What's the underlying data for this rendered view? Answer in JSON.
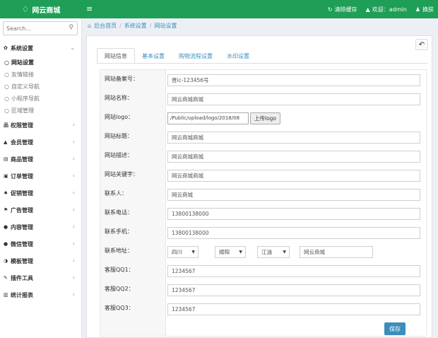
{
  "header": {
    "logo_text": "网云商城",
    "clear_cache": "清除缓存",
    "welcome": "欢迎：admin",
    "switch_skin": "换肤"
  },
  "sidebar": {
    "search_placeholder": "Search...",
    "groups": [
      {
        "label": "系统设置",
        "icon": "gear-icon",
        "expanded": true
      },
      {
        "label": "权限管理",
        "icon": "sitemap-icon"
      },
      {
        "label": "会员管理",
        "icon": "user-icon"
      },
      {
        "label": "商品管理",
        "icon": "box-icon"
      },
      {
        "label": "订单管理",
        "icon": "order-icon"
      },
      {
        "label": "促销管理",
        "icon": "bell-icon"
      },
      {
        "label": "广告管理",
        "icon": "flag-icon"
      },
      {
        "label": "内容管理",
        "icon": "comment-icon"
      },
      {
        "label": "微信管理",
        "icon": "wechat-icon"
      },
      {
        "label": "模板管理",
        "icon": "template-icon"
      },
      {
        "label": "插件工具",
        "icon": "plugin-icon"
      },
      {
        "label": "统计报表",
        "icon": "chart-icon"
      }
    ],
    "sub_items": [
      "网站设置",
      "友情链接",
      "自定义导航",
      "小程序导航",
      "区域管理"
    ]
  },
  "breadcrumb": [
    "后台首页",
    "系统设置",
    "网站设置"
  ],
  "tabs": [
    "网站信息",
    "基本设置",
    "购物流程设置",
    "水印设置"
  ],
  "form": {
    "fields": [
      {
        "label": "网站备案号：",
        "value": "晋ic-123456号"
      },
      {
        "label": "网站名称：",
        "value": "网云商城商城"
      },
      {
        "label": "网站logo：",
        "value": "/Public/upload/logo/2018/08"
      },
      {
        "label": "网站标题：",
        "value": "网云商城商城"
      },
      {
        "label": "网站描述：",
        "value": "网云商城商城"
      },
      {
        "label": "网站关键字：",
        "value": "网云商城商城"
      },
      {
        "label": "联系人：",
        "value": "网云商城"
      },
      {
        "label": "联系电话：",
        "value": "13800138000"
      },
      {
        "label": "联系手机：",
        "value": "13800138000"
      },
      {
        "label": "联系地址：",
        "value": "网云商城"
      },
      {
        "label": "客服QQ1：",
        "value": "1234567"
      },
      {
        "label": "客服QQ2：",
        "value": "1234567"
      },
      {
        "label": "客服QQ3：",
        "value": "1234567"
      }
    ],
    "upload_label": "上传logo",
    "province": "四川",
    "city": "绵阳",
    "district": "江油",
    "save_label": "保存"
  }
}
